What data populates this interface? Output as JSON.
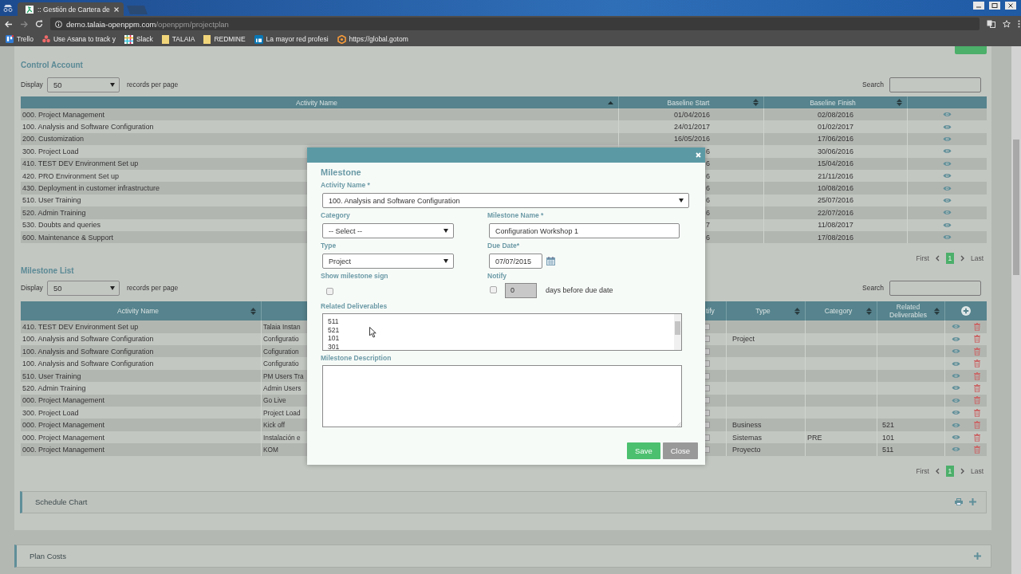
{
  "browser": {
    "tab_title": ":: Gestión de Cartera de",
    "url_host": "demo.talaia-openppm.com",
    "url_path": "/openppm/projectplan",
    "bookmarks": [
      {
        "label": "Trello",
        "kind": "board"
      },
      {
        "label": "Use Asana to track y",
        "kind": "dots"
      },
      {
        "label": "Slack",
        "kind": "grid"
      },
      {
        "label": "TALAIA",
        "kind": "folder"
      },
      {
        "label": "REDMINE",
        "kind": "folder"
      },
      {
        "label": "La mayor red profesi",
        "kind": "square"
      },
      {
        "label": "https://global.gotom",
        "kind": "hexagon"
      }
    ]
  },
  "control_account": {
    "title": "Control Account",
    "display_label": "Display",
    "page_size": "50",
    "records_label": "records per page",
    "search_label": "Search",
    "columns": [
      {
        "label": "Activity Name",
        "sorted": true
      },
      {
        "label": "Baseline Start",
        "sorted": false
      },
      {
        "label": "Baseline Finish",
        "sorted": false
      }
    ],
    "rows": [
      {
        "activity": "000. Project Management",
        "start": "01/04/2016",
        "finish": "02/08/2016"
      },
      {
        "activity": "100. Analysis and Software Configuration",
        "start": "24/01/2017",
        "finish": "01/02/2017"
      },
      {
        "activity": "200. Customization",
        "start": "16/05/2016",
        "finish": "17/06/2016"
      },
      {
        "activity": "300. Project Load",
        "start": "6",
        "finish": "30/06/2016"
      },
      {
        "activity": "410. TEST DEV Environment Set up",
        "start": "6",
        "finish": "15/04/2016"
      },
      {
        "activity": "420. PRO Environment Set up",
        "start": "6",
        "finish": "21/11/2016"
      },
      {
        "activity": "430. Deployment in customer infrastructure",
        "start": "6",
        "finish": "10/08/2016"
      },
      {
        "activity": "510. User Training",
        "start": "6",
        "finish": "25/07/2016"
      },
      {
        "activity": "520. Admin Training",
        "start": "6",
        "finish": "22/07/2016"
      },
      {
        "activity": "530. Doubts and queries",
        "start": "7",
        "finish": "11/08/2017"
      },
      {
        "activity": "600. Maintenance & Support",
        "start": "6",
        "finish": "17/08/2016"
      }
    ],
    "pagination": {
      "first": "First",
      "last": "Last",
      "pages": [
        {
          "label": "1",
          "selected": true
        }
      ]
    }
  },
  "milestone_list": {
    "title": "Milestone List",
    "display_label": "Display",
    "page_size": "50",
    "records_label": "records per page",
    "search_label": "Search",
    "columns": [
      {
        "label": "Activity Name",
        "sorted": false
      },
      {
        "label": "tify"
      },
      {
        "label": "Type",
        "sorted": false
      },
      {
        "label": "Category",
        "sorted": false
      },
      {
        "label": "Related Deliverables",
        "sorted": false
      }
    ],
    "rows": [
      {
        "activity": "410. TEST DEV Environment Set up",
        "milestone_name": "Talaia Instan",
        "notify": false
      },
      {
        "activity": "100. Analysis and Software Configuration",
        "milestone_name": "Configuratio",
        "notify": false,
        "type": "Project"
      },
      {
        "activity": "100. Analysis and Software Configuration",
        "milestone_name": "Cofiguration",
        "notify": false
      },
      {
        "activity": "100. Analysis and Software Configuration",
        "milestone_name": "Configuratio",
        "notify": false
      },
      {
        "activity": "510. User Training",
        "milestone_name": "PM Users Tra",
        "notify": false
      },
      {
        "activity": "520. Admin Training",
        "milestone_name": "Admin Users",
        "notify": false
      },
      {
        "activity": "000. Project Management",
        "milestone_name": "Go Live",
        "notify": false
      },
      {
        "activity": "300. Project Load",
        "milestone_name": "Project Load",
        "notify": false
      },
      {
        "activity": "000. Project Management",
        "milestone_name": "Kick off",
        "notify": false,
        "type": "Business",
        "deliverables": "521"
      },
      {
        "activity": "000. Project Management",
        "milestone_name": "Instalación e",
        "notify": false,
        "type": "Sistemas",
        "category": "PRE",
        "deliverables": "101"
      },
      {
        "activity": "000. Project Management",
        "milestone_name": "KOM",
        "notify": false,
        "type": "Proyecto",
        "deliverables": "511"
      }
    ],
    "pagination": {
      "first": "First",
      "last": "Last",
      "pages": [
        {
          "label": "1",
          "selected": true
        }
      ]
    }
  },
  "panels": [
    {
      "title": "Schedule Chart",
      "printable": true
    },
    {
      "title": "Plan Costs",
      "printable": false
    }
  ],
  "modal": {
    "title": "Milestone",
    "activity_label": "Activity Name *",
    "activity_value": "100. Analysis and Software Configuration",
    "category_label": "Category",
    "category_value": "-- Select --",
    "name_label": "Milestone Name *",
    "name_value": "Configuration Workshop 1",
    "type_label": "Type",
    "type_value": "Project",
    "due_label": "Due Date*",
    "due_value": "07/07/2015",
    "sign_label": "Show milestone sign",
    "sign_checked": false,
    "notify_label": "Notify",
    "notify_checked": false,
    "notify_days": "0",
    "notify_days_disabled": true,
    "notify_suffix": "days before due date",
    "deliverables_label": "Related Deliverables",
    "deliverables": [
      "511",
      "521",
      "101",
      "301"
    ],
    "description_label": "Milestone Description",
    "buttons": [
      {
        "label": "Save",
        "kind": "primary"
      },
      {
        "label": "Close",
        "kind": "secondary"
      }
    ]
  }
}
